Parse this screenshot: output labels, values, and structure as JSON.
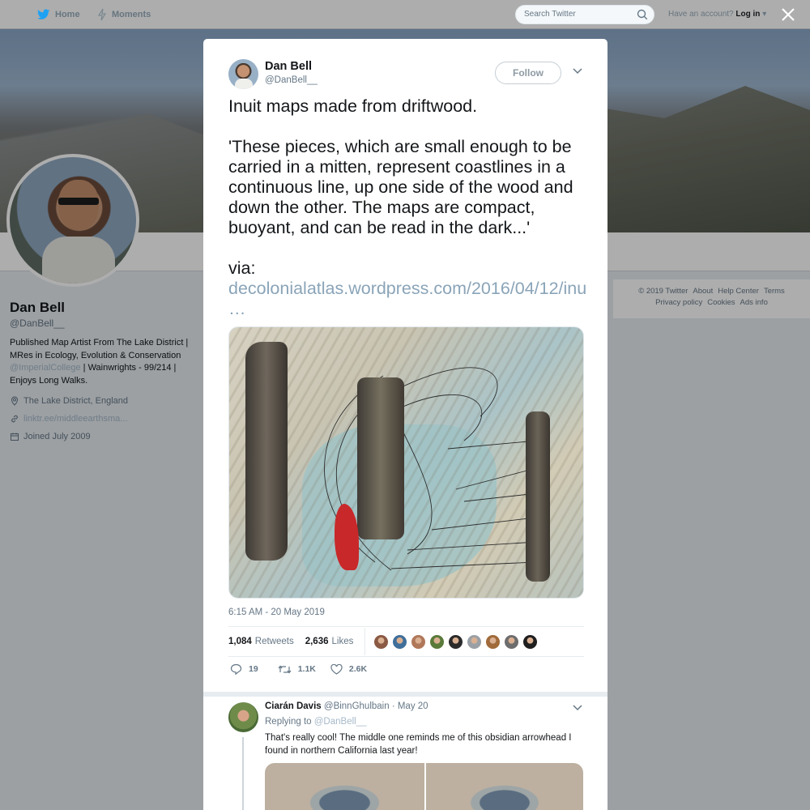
{
  "nav": {
    "home": "Home",
    "moments": "Moments",
    "search_placeholder": "Search Twitter",
    "have_account": "Have an account?",
    "login": "Log in"
  },
  "profile": {
    "name": "Dan Bell",
    "handle": "@DanBell__",
    "bio_part1": "Published Map Artist From The Lake District | MRes in Ecology, Evolution & Conservation ",
    "bio_mention": "@ImperialCollege",
    "bio_part2": " | Wainwrights - 99/214 | Enjoys Long Walks.",
    "location": "The Lake District, England",
    "website": "linktr.ee/middleearthsma...",
    "joined": "Joined July 2009"
  },
  "footer": {
    "copyright": "© 2019 Twitter",
    "about": "About",
    "help": "Help Center",
    "terms": "Terms",
    "privacy": "Privacy policy",
    "cookies": "Cookies",
    "ads": "Ads info"
  },
  "tweet": {
    "name": "Dan Bell",
    "handle": "@DanBell__",
    "follow_label": "Follow",
    "text": "Inuit maps made from driftwood.\n\n'These pieces, which are small enough to be carried in a mitten, represent coastlines in a continuous line, up one side of the wood and down the other. The maps are compact, buoyant, and can be read in the dark...'\n\nvia:",
    "link": " decolonialatlas.wordpress.com/2016/04/12/inu …",
    "timestamp": "6:15 AM - 20 May 2019",
    "retweets_count": "1,084",
    "retweets_label": "Retweets",
    "likes_count": "2,636",
    "likes_label": "Likes",
    "reply_count": "19",
    "retweet_action_count": "1.1K",
    "like_action_count": "2.6K",
    "liker_colors": [
      "#8a5a44",
      "#3f6f9a",
      "#b0785a",
      "#5a7a3a",
      "#2b2b2b",
      "#9aa0a6",
      "#a06a3a",
      "#6d6d6d",
      "#1f1f1f"
    ]
  },
  "reply": {
    "name": "Ciarán Davis",
    "handle": "@BinnGhulbain",
    "date": "· May 20",
    "replying_to_label": "Replying to",
    "replying_to_handle": "@DanBell__",
    "text": "That's really cool! The middle one reminds me of this obsidian arrowhead I found in northern California last year!"
  }
}
